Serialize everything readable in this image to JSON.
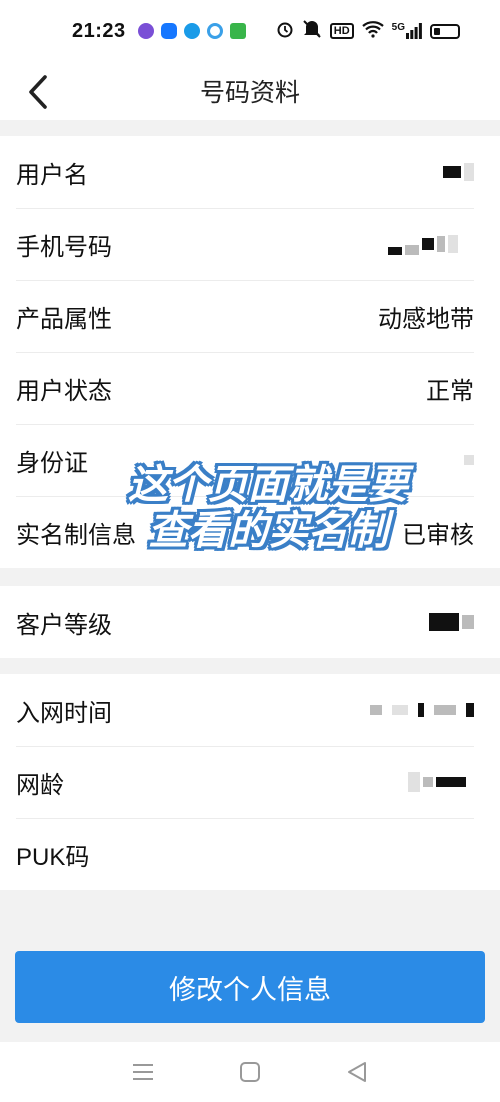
{
  "status_bar": {
    "time": "21:23",
    "network": "5G",
    "hd": "HD",
    "app_icons": [
      {
        "name": "chat-app-icon",
        "color": "#7a4fd6"
      },
      {
        "name": "alipay-icon",
        "color": "#1677ff"
      },
      {
        "name": "browser-icon",
        "color": "#1a9be8"
      },
      {
        "name": "circle-app-icon",
        "color": "#3aa0e8"
      },
      {
        "name": "play-app-icon",
        "color": "#39b54a"
      }
    ]
  },
  "header": {
    "title": "号码资料",
    "back_icon": "chevron-left-icon"
  },
  "section1": {
    "rows": [
      {
        "label": "用户名",
        "value": ""
      },
      {
        "label": "手机号码",
        "value": ""
      },
      {
        "label": "产品属性",
        "value": "动感地带"
      },
      {
        "label": "用户状态",
        "value": "正常"
      },
      {
        "label": "身份证",
        "value": ""
      },
      {
        "label": "实名制信息",
        "value": "已审核"
      }
    ]
  },
  "section2": {
    "rows": [
      {
        "label": "客户等级",
        "value": ""
      }
    ]
  },
  "section3": {
    "rows": [
      {
        "label": "入网时间",
        "value": ""
      },
      {
        "label": "网龄",
        "value": ""
      },
      {
        "label": "PUK码",
        "value": ""
      }
    ]
  },
  "overlay_caption": {
    "line1": "这个页面就是要",
    "line2": "查看的实名制"
  },
  "edit_button": {
    "label": "修改个人信息"
  },
  "colors": {
    "accent": "#2b8be6",
    "caption_outline": "#3a7fc7",
    "background": "#f2f2f2"
  }
}
